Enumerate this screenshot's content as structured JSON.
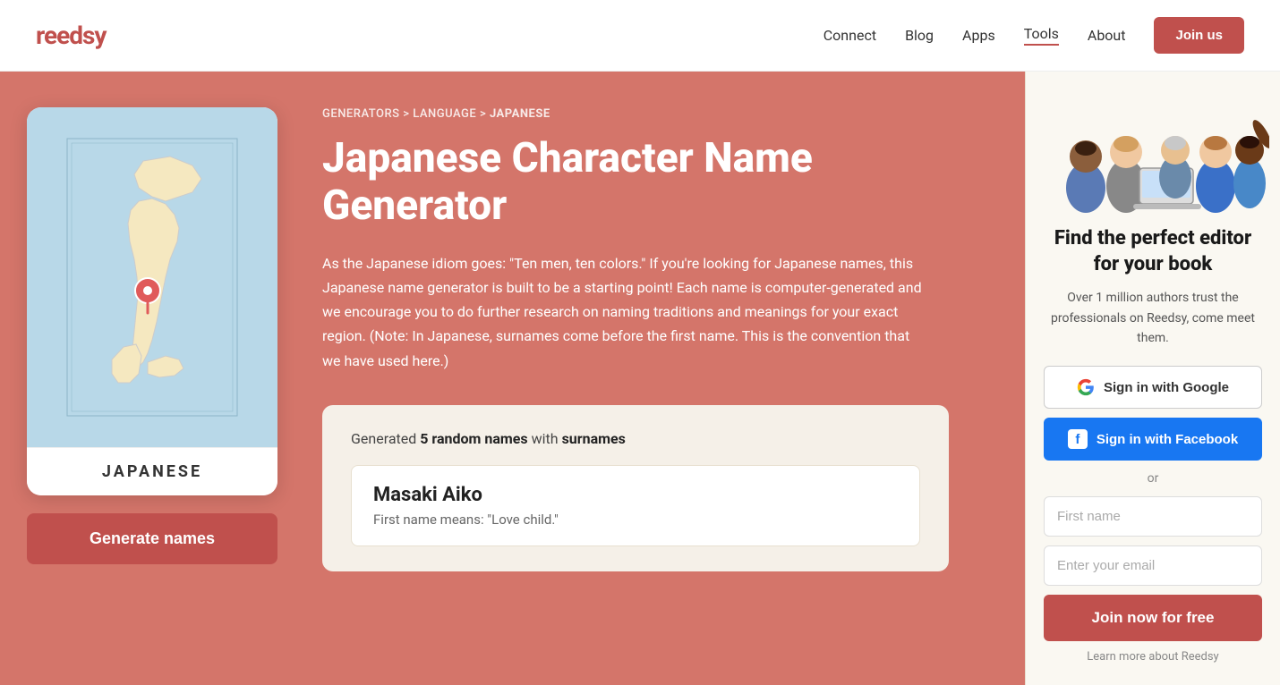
{
  "header": {
    "logo": "reedsy",
    "nav": [
      {
        "label": "Connect",
        "active": false
      },
      {
        "label": "Blog",
        "active": false
      },
      {
        "label": "Apps",
        "active": false
      },
      {
        "label": "Tools",
        "active": true
      },
      {
        "label": "About",
        "active": false
      }
    ],
    "join_btn": "Join us"
  },
  "breadcrumb": {
    "items": [
      "GENERATORS",
      "LANGUAGE",
      "JAPANESE"
    ]
  },
  "hero": {
    "title": "Japanese Character Name Generator",
    "description": "As the Japanese idiom goes: \"Ten men, ten colors.\" If you're looking for Japanese names, this Japanese name generator is built to be a starting point! Each name is computer-generated and we encourage you to do further research on naming traditions and meanings for your exact region. (Note: In Japanese, surnames come before the first name. This is the convention that we have used here.)",
    "card_label": "JAPANESE",
    "generate_btn": "Generate names"
  },
  "results": {
    "summary_prefix": "Generated ",
    "summary_count": "5 random names",
    "summary_mid": " with ",
    "summary_type": "surnames",
    "name": "Masaki Aiko",
    "name_meaning": "First name means: \"Love child.\""
  },
  "sidebar": {
    "title": "Find the perfect editor for your book",
    "description": "Over 1 million authors trust the professionals on Reedsy, come meet them.",
    "google_btn": "Sign in with Google",
    "facebook_btn": "Sign in with Facebook",
    "or": "or",
    "first_name_placeholder": "First name",
    "email_placeholder": "Enter your email",
    "join_btn": "Join now for free",
    "learn_more": "Learn more about Reedsy"
  }
}
